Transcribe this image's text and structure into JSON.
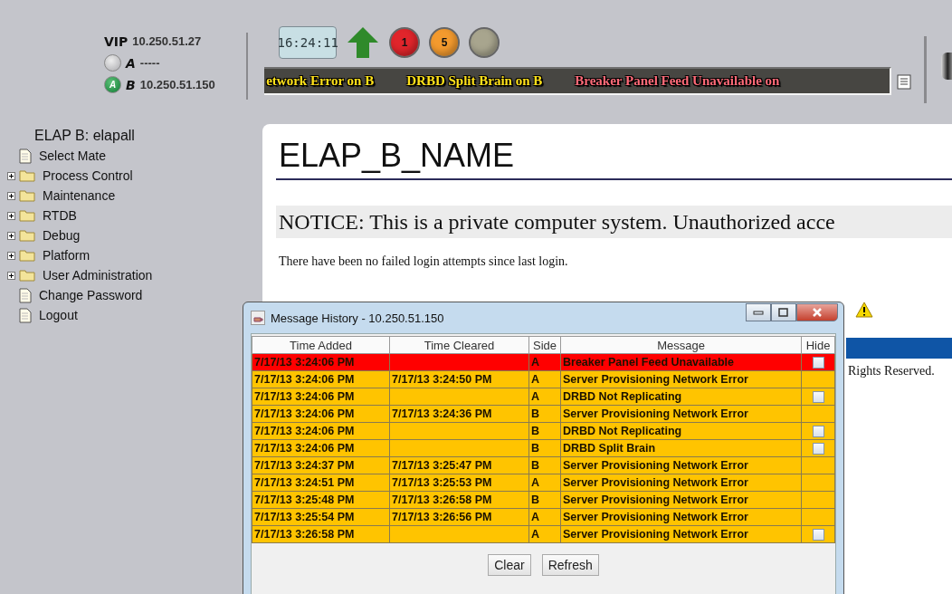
{
  "status": {
    "vip_label": "VIP",
    "vip": "10.250.51.27",
    "servers": [
      {
        "label": "A",
        "address": "-----",
        "active": false
      },
      {
        "label": "B",
        "address": "10.250.51.150",
        "active": true,
        "badge": "A"
      }
    ]
  },
  "clock": "16:24:11",
  "alarm_counters": [
    {
      "count": "1",
      "color": "#e0252b"
    },
    {
      "count": "5",
      "color": "#f39a2e"
    },
    {
      "color": "#a8a58e"
    }
  ],
  "ticker": [
    {
      "text": "etwork Error on B",
      "color": "#ffe11a"
    },
    {
      "text": "DRBD Split Brain on B",
      "color": "#ffe11a"
    },
    {
      "text": "Breaker Panel Feed Unavailable on",
      "color": "#ff6a78"
    }
  ],
  "sidebar": {
    "title": "ELAP B: elapall",
    "items": [
      {
        "label": "Select Mate",
        "kind": "page"
      },
      {
        "label": "Process Control",
        "kind": "folder",
        "expanded": false
      },
      {
        "label": "Maintenance",
        "kind": "folder",
        "expanded": false
      },
      {
        "label": "RTDB",
        "kind": "folder",
        "expanded": false
      },
      {
        "label": "Debug",
        "kind": "folder",
        "expanded": false
      },
      {
        "label": "Platform",
        "kind": "folder",
        "expanded": false
      },
      {
        "label": "User Administration",
        "kind": "folder",
        "expanded": false
      },
      {
        "label": "Change Password",
        "kind": "page"
      },
      {
        "label": "Logout",
        "kind": "page"
      }
    ]
  },
  "main": {
    "title": "ELAP_B_NAME",
    "notice": "NOTICE: This is a private computer system. Unauthorized acce",
    "login_info": "There have been no failed login attempts since last login.",
    "footer": "Rights Reserved."
  },
  "dialog": {
    "title": "Message History - 10.250.51.150",
    "columns": [
      "Time Added",
      "Time Cleared",
      "Side",
      "Message",
      "Hide"
    ],
    "rows": [
      {
        "added": "7/17/13 3:24:06 PM",
        "cleared": "",
        "side": "A",
        "message": "Breaker Panel Feed Unavailable",
        "color": "#ff0000",
        "hide": {
          "checked": false
        }
      },
      {
        "added": "7/17/13 3:24:06 PM",
        "cleared": "7/17/13 3:24:50 PM",
        "side": "A",
        "message": "Server Provisioning Network Error",
        "color": "#ffc400"
      },
      {
        "added": "7/17/13 3:24:06 PM",
        "cleared": "",
        "side": "A",
        "message": "DRBD Not Replicating",
        "color": "#ffc400",
        "hide": {
          "checked": false
        }
      },
      {
        "added": "7/17/13 3:24:06 PM",
        "cleared": "7/17/13 3:24:36 PM",
        "side": "B",
        "message": "Server Provisioning Network Error",
        "color": "#ffc400"
      },
      {
        "added": "7/17/13 3:24:06 PM",
        "cleared": "",
        "side": "B",
        "message": "DRBD Not Replicating",
        "color": "#ffc400",
        "hide": {
          "checked": false
        }
      },
      {
        "added": "7/17/13 3:24:06 PM",
        "cleared": "",
        "side": "B",
        "message": "DRBD Split Brain",
        "color": "#ffc400",
        "hide": {
          "checked": false
        }
      },
      {
        "added": "7/17/13 3:24:37 PM",
        "cleared": "7/17/13 3:25:47 PM",
        "side": "B",
        "message": "Server Provisioning Network Error",
        "color": "#ffc400"
      },
      {
        "added": "7/17/13 3:24:51 PM",
        "cleared": "7/17/13 3:25:53 PM",
        "side": "A",
        "message": "Server Provisioning Network Error",
        "color": "#ffc400"
      },
      {
        "added": "7/17/13 3:25:48 PM",
        "cleared": "7/17/13 3:26:58 PM",
        "side": "B",
        "message": "Server Provisioning Network Error",
        "color": "#ffc400"
      },
      {
        "added": "7/17/13 3:25:54 PM",
        "cleared": "7/17/13 3:26:56 PM",
        "side": "A",
        "message": "Server Provisioning Network Error",
        "color": "#ffc400"
      },
      {
        "added": "7/17/13 3:26:58 PM",
        "cleared": "",
        "side": "A",
        "message": "Server Provisioning Network Error",
        "color": "#ffc400",
        "hide": {
          "checked": false
        }
      }
    ],
    "buttons": [
      "Clear",
      "Refresh"
    ]
  }
}
